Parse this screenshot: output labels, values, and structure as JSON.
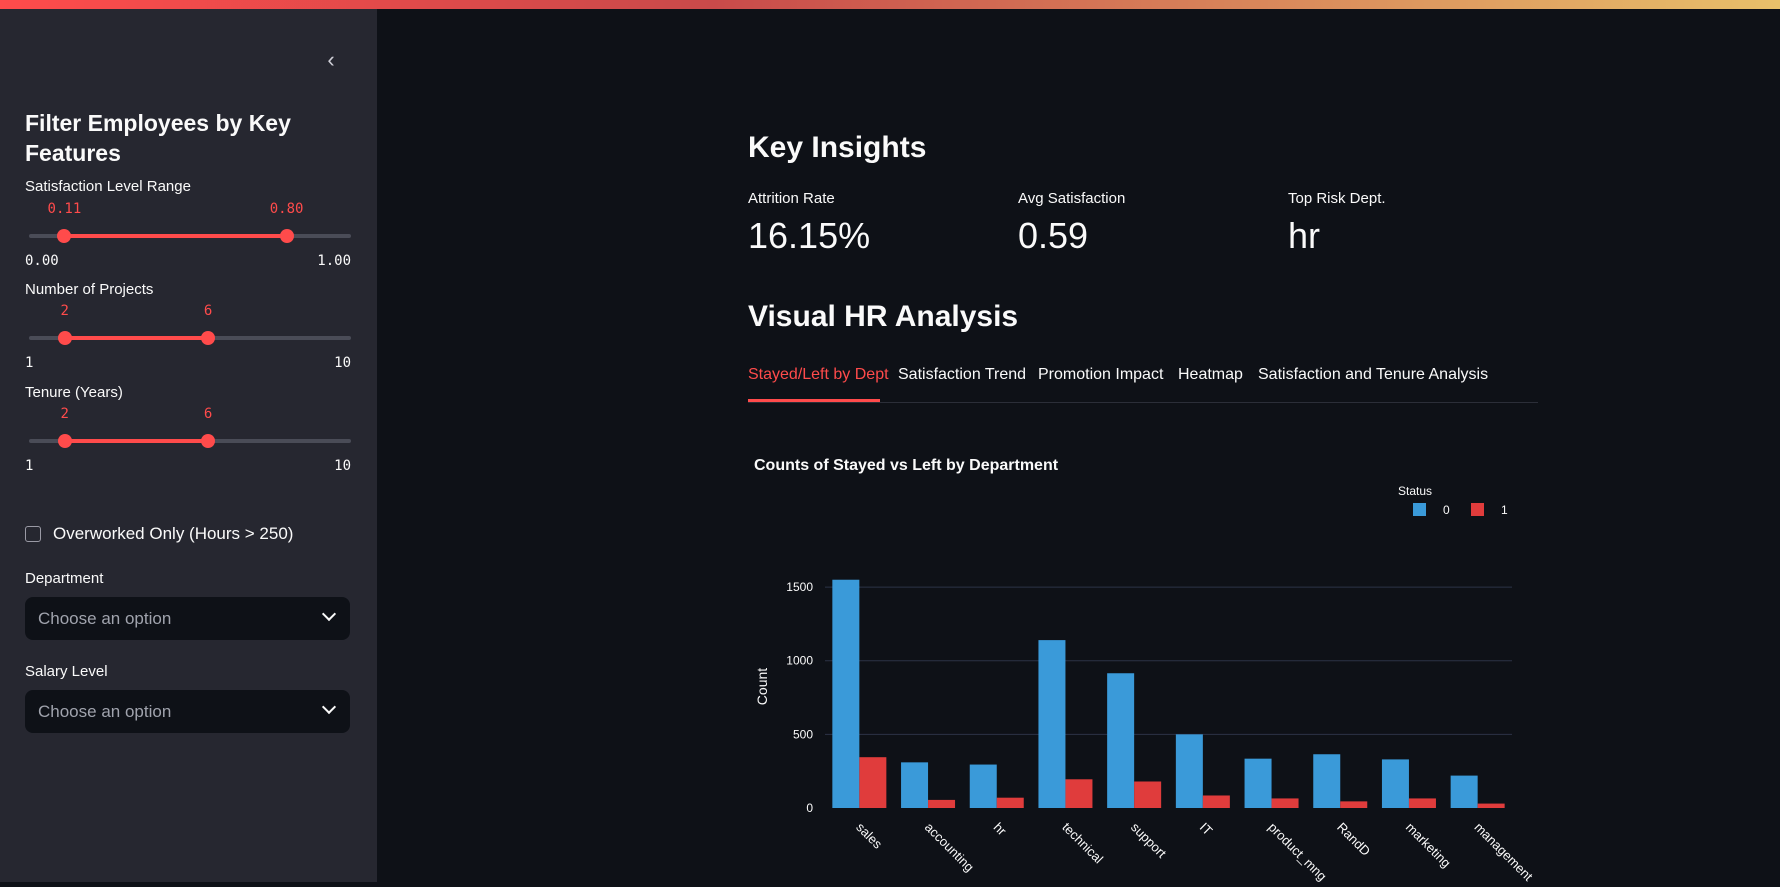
{
  "sidebar": {
    "collapse_icon": "chevron-left-icon",
    "title": "Filter Employees by Key Features",
    "sliders": [
      {
        "label": "Satisfaction Level Range",
        "low": "0.11",
        "high": "0.80",
        "min": "0.00",
        "max": "1.00",
        "low_frac": 0.11,
        "high_frac": 0.8
      },
      {
        "label": "Number of Projects",
        "low": "2",
        "high": "6",
        "min": "1",
        "max": "10",
        "low_frac": 0.111,
        "high_frac": 0.556
      },
      {
        "label": "Tenure (Years)",
        "low": "2",
        "high": "6",
        "min": "1",
        "max": "10",
        "low_frac": 0.111,
        "high_frac": 0.556
      }
    ],
    "checkbox": {
      "label": "Overworked Only (Hours > 250)",
      "checked": false
    },
    "department": {
      "label": "Department",
      "placeholder": "Choose an option"
    },
    "salary": {
      "label": "Salary Level",
      "placeholder": "Choose an option"
    }
  },
  "main": {
    "insights_title": "Key Insights",
    "metrics": [
      {
        "label": "Attrition Rate",
        "value": "16.15%"
      },
      {
        "label": "Avg Satisfaction",
        "value": "0.59"
      },
      {
        "label": "Top Risk Dept.",
        "value": "hr"
      }
    ],
    "analysis_title": "Visual HR Analysis",
    "tabs": [
      {
        "label": "Stayed/Left by Dept",
        "active": true
      },
      {
        "label": "Satisfaction Trend",
        "active": false
      },
      {
        "label": "Promotion Impact",
        "active": false
      },
      {
        "label": "Heatmap",
        "active": false
      },
      {
        "label": "Satisfaction and Tenure Analysis",
        "active": false
      }
    ]
  },
  "colors": {
    "accent": "#ff4b4b",
    "series0": "#3a9ad9",
    "series1": "#e03c3c",
    "background": "#0e1117",
    "sidebar": "#262730"
  },
  "chart_data": {
    "type": "bar",
    "title": "Counts of Stayed vs Left by Department",
    "xlabel": "",
    "ylabel": "Count",
    "legend_title": "Status",
    "legend_position": "top-right",
    "categories": [
      "sales",
      "accounting",
      "hr",
      "technical",
      "support",
      "IT",
      "product_mng",
      "RandD",
      "marketing",
      "management"
    ],
    "series": [
      {
        "name": "0",
        "values": [
          1550,
          310,
          295,
          1140,
          915,
          500,
          335,
          365,
          330,
          220
        ]
      },
      {
        "name": "1",
        "values": [
          345,
          55,
          70,
          195,
          180,
          85,
          65,
          45,
          65,
          30
        ]
      }
    ],
    "yticks": [
      0,
      500,
      1000,
      1500
    ],
    "ylim": [
      0,
      1650
    ],
    "grid": true
  }
}
